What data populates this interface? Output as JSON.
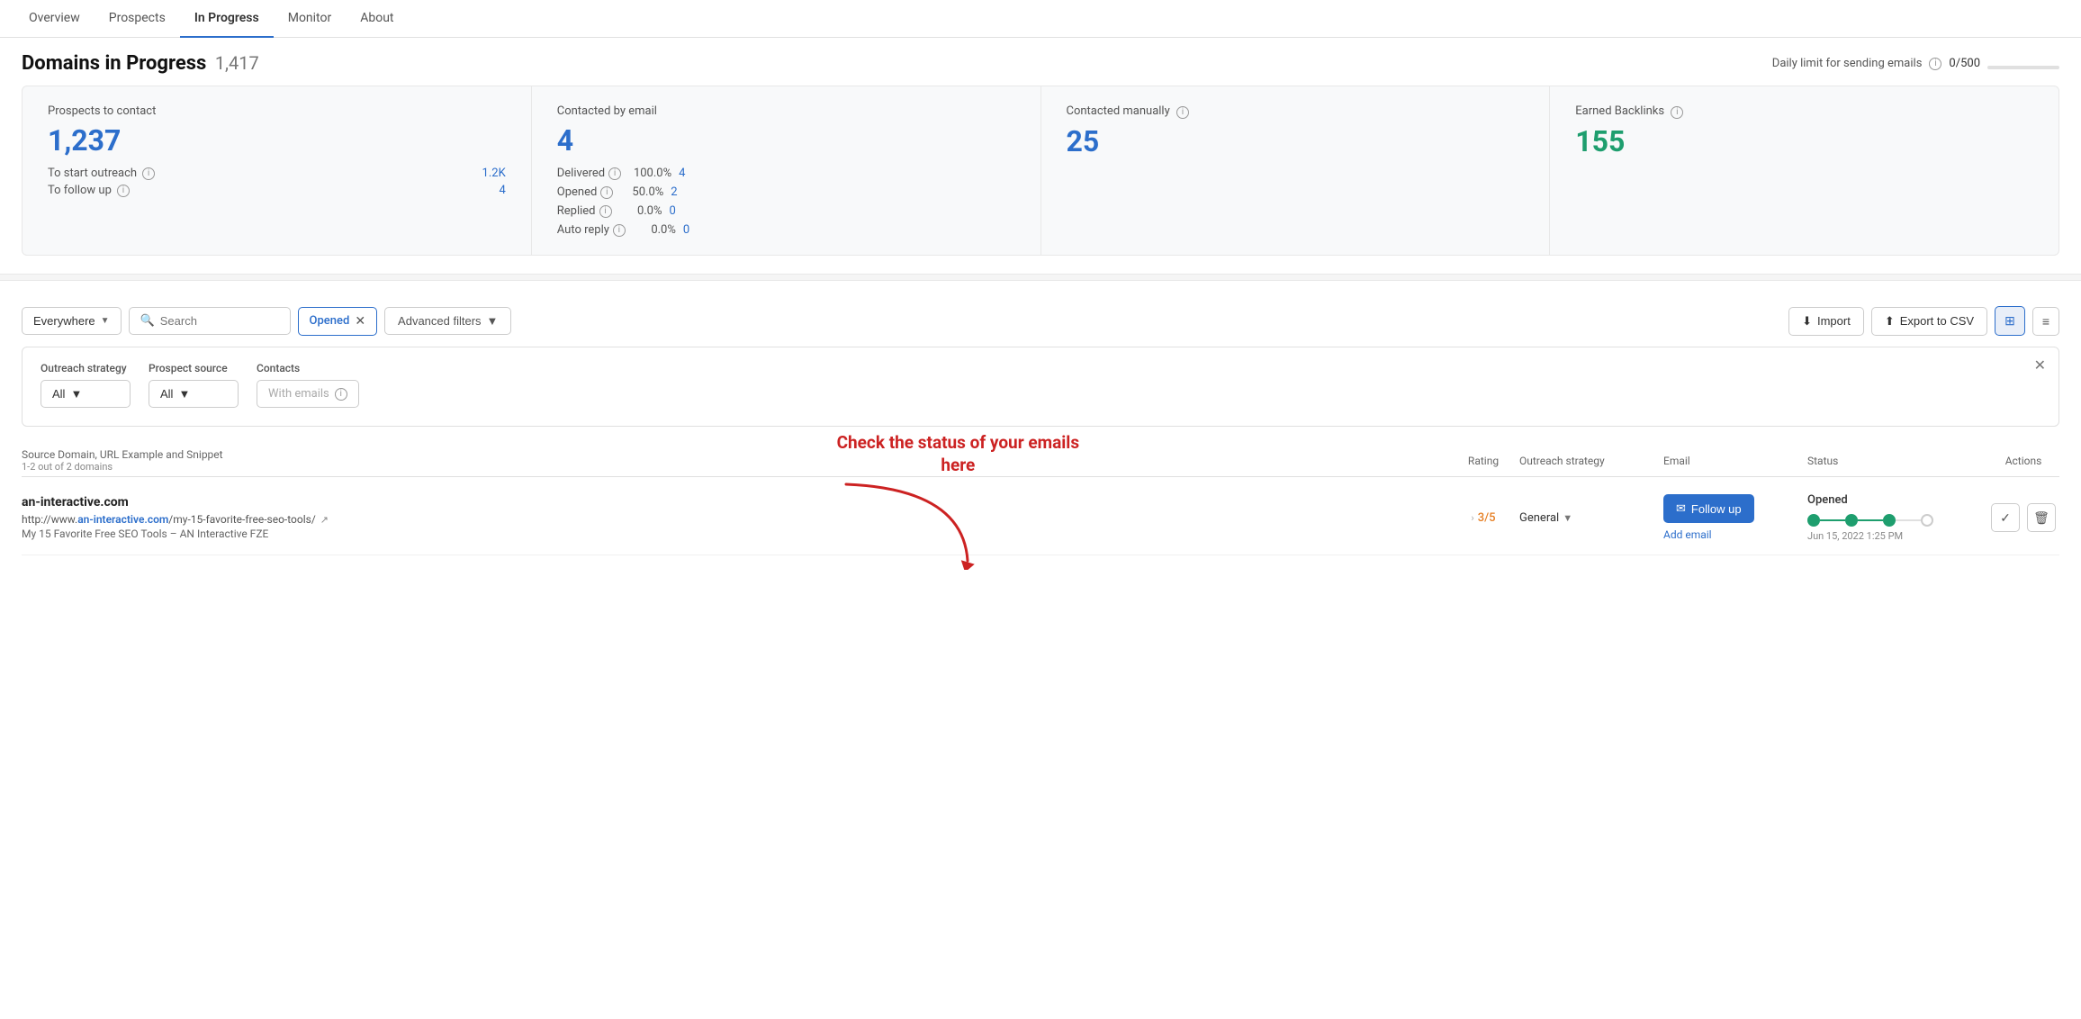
{
  "nav": {
    "tabs": [
      {
        "label": "Overview",
        "active": false
      },
      {
        "label": "Prospects",
        "active": false
      },
      {
        "label": "In Progress",
        "active": true
      },
      {
        "label": "Monitor",
        "active": false
      },
      {
        "label": "About",
        "active": false
      }
    ]
  },
  "header": {
    "title": "Domains in Progress",
    "count": "1,417",
    "daily_limit_label": "Daily limit for sending emails",
    "daily_limit_value": "0/500"
  },
  "stats": [
    {
      "id": "prospects",
      "label": "Prospects to contact",
      "value": "1,237",
      "color": "blue",
      "sub_rows": [
        {
          "label": "To start outreach",
          "value": "1.2K"
        },
        {
          "label": "To follow up",
          "value": "4"
        }
      ]
    },
    {
      "id": "email",
      "label": "Contacted by email",
      "value": "4",
      "color": "blue",
      "email_rows": [
        {
          "label": "Delivered",
          "pct": "100.0%",
          "val": "4"
        },
        {
          "label": "Opened",
          "pct": "50.0%",
          "val": "2"
        },
        {
          "label": "Replied",
          "pct": "0.0%",
          "val": "0"
        },
        {
          "label": "Auto reply",
          "pct": "0.0%",
          "val": "0"
        }
      ]
    },
    {
      "id": "manual",
      "label": "Contacted manually",
      "value": "25",
      "color": "blue"
    },
    {
      "id": "backlinks",
      "label": "Earned Backlinks",
      "value": "155",
      "color": "green"
    }
  ],
  "filters": {
    "everywhere_label": "Everywhere",
    "search_placeholder": "Search",
    "active_filter": "Opened",
    "adv_filters_label": "Advanced filters",
    "import_label": "Import",
    "export_label": "Export to CSV"
  },
  "adv_filters": {
    "outreach_label": "Outreach strategy",
    "outreach_value": "All",
    "source_label": "Prospect source",
    "source_value": "All",
    "contacts_label": "Contacts",
    "contacts_value": "With emails"
  },
  "table": {
    "cols": {
      "source": "Source Domain, URL Example and Snippet",
      "source_sub": "1-2 out of 2 domains",
      "rating": "Rating",
      "outreach": "Outreach strategy",
      "email": "Email",
      "status": "Status",
      "actions": "Actions"
    },
    "rows": [
      {
        "domain": "an-interactive.com",
        "url": "http://www.an-interactive.com/my-15-favorite-free-seo-tools/",
        "url_bold": "an-interactive.com",
        "snippet": "My 15 Favorite Free SEO Tools – AN Interactive FZE",
        "rating": "3/5",
        "outreach": "General",
        "email_action": "Follow up",
        "email_sub": "Add email",
        "status_label": "Opened",
        "status_date": "Jun 15, 2022 1:25 PM",
        "timeline": [
          {
            "filled": true
          },
          {
            "filled": true
          },
          {
            "filled": true
          },
          {
            "filled": false
          }
        ]
      }
    ]
  },
  "annotation": {
    "text_line1": "Check the status of your emails",
    "text_line2": "here"
  }
}
